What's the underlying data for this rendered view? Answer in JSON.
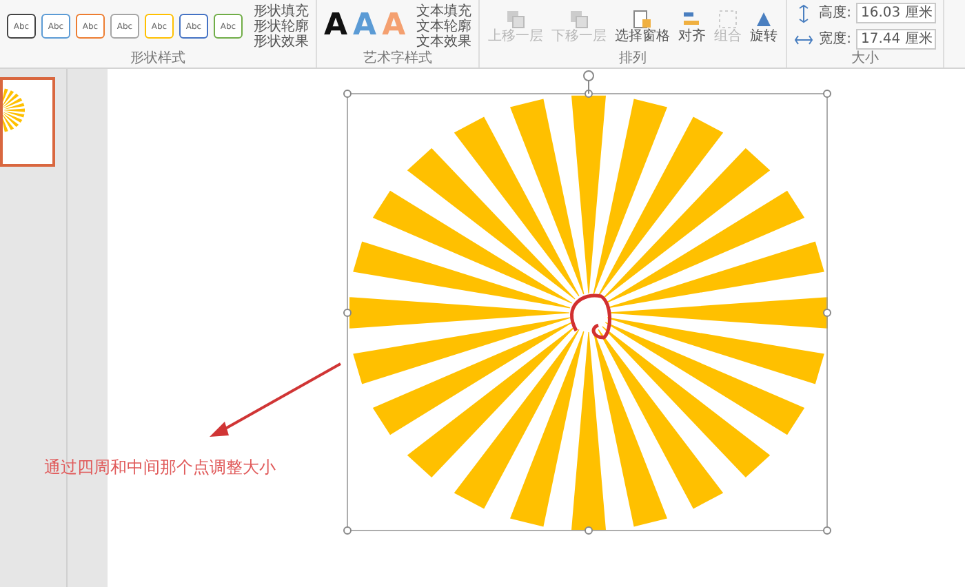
{
  "ribbon": {
    "groups": [
      {
        "kind": "shape_styles",
        "label": "形状样式",
        "swatches": [
          {
            "text": "Abc",
            "color": "#444444"
          },
          {
            "text": "Abc",
            "color": "#5b9bd5"
          },
          {
            "text": "Abc",
            "color": "#ed7d31"
          },
          {
            "text": "Abc",
            "color": "#a5a5a5"
          },
          {
            "text": "Abc",
            "color": "#ffc000"
          },
          {
            "text": "Abc",
            "color": "#4472c4"
          },
          {
            "text": "Abc",
            "color": "#70ad47"
          }
        ],
        "menu": [
          "形状填充",
          "形状轮廓",
          "形状效果"
        ]
      },
      {
        "kind": "wordart",
        "label": "艺术字样式",
        "letters": [
          {
            "text": "A",
            "color": "#111111"
          },
          {
            "text": "A",
            "color": "#5b9bd5"
          },
          {
            "text": "A",
            "color": "#f4a070"
          }
        ],
        "menu": [
          "文本填充",
          "文本轮廓",
          "文本效果"
        ]
      },
      {
        "kind": "arrange",
        "label": "排列",
        "buttons": [
          {
            "label": "上移一层",
            "disabled": true
          },
          {
            "label": "下移一层",
            "disabled": true
          },
          {
            "label": "选择窗格",
            "disabled": false
          },
          {
            "label": "对齐",
            "disabled": false
          },
          {
            "label": "组合",
            "disabled": true
          },
          {
            "label": "旋转",
            "disabled": false
          }
        ]
      },
      {
        "kind": "size",
        "label": "大小",
        "fields": [
          {
            "label": "高度:",
            "value": "16.03 厘米"
          },
          {
            "label": "宽度:",
            "value": "17.44 厘米"
          }
        ]
      }
    ]
  },
  "thumbnails": [
    {
      "selected": true
    }
  ],
  "caption": "通过四周和中间那个点调整大小"
}
